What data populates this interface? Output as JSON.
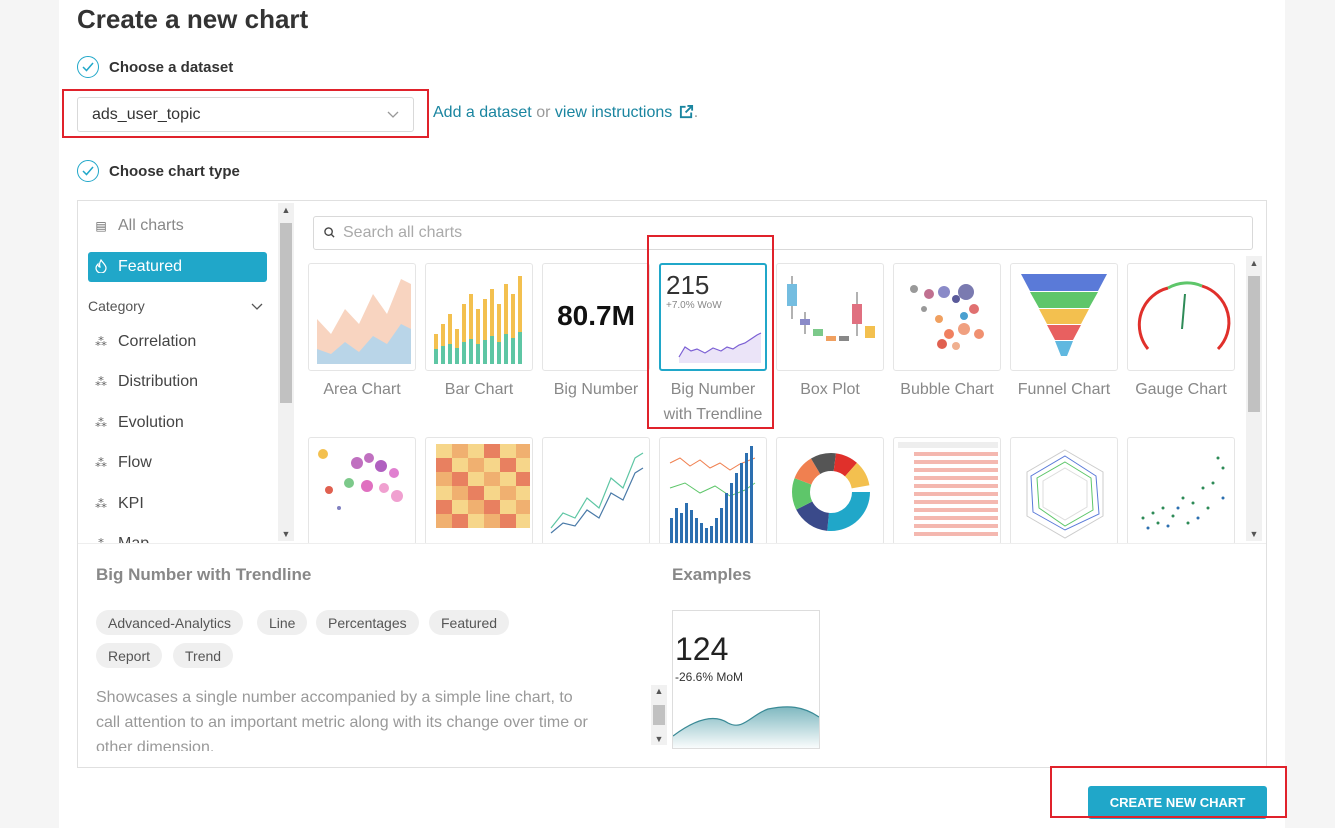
{
  "title": "Create a new chart",
  "steps": {
    "dataset": "Choose a dataset",
    "chart_type": "Choose chart type"
  },
  "dataset": {
    "value": "ads_user_topic",
    "add_link": "Add a dataset",
    "or": "or",
    "instructions_link": "view instructions",
    "period": "."
  },
  "sidebar": {
    "all_charts": "All charts",
    "featured": "Featured",
    "category_label": "Category",
    "categories": [
      "Correlation",
      "Distribution",
      "Evolution",
      "Flow",
      "KPI",
      "Map"
    ]
  },
  "search": {
    "placeholder": "Search all charts"
  },
  "charts": [
    {
      "name": "Area Chart"
    },
    {
      "name": "Bar Chart"
    },
    {
      "name": "Big Number",
      "thumb_value": "80.7M"
    },
    {
      "name": "Big Number with Trendline",
      "line1": "Big Number",
      "line2": "with Trendline",
      "thumb_value": "215",
      "thumb_sub": "+7.0% WoW",
      "selected": true
    },
    {
      "name": "Box Plot"
    },
    {
      "name": "Bubble Chart"
    },
    {
      "name": "Funnel Chart"
    },
    {
      "name": "Gauge Chart"
    }
  ],
  "detail": {
    "title": "Big Number with Trendline",
    "tags": [
      "Advanced-Analytics",
      "Line",
      "Percentages",
      "Featured",
      "Report",
      "Trend"
    ],
    "description": "Showcases a single number accompanied by a simple line chart, to call attention to an important metric along with its change over time or other dimension.",
    "examples_label": "Examples",
    "example_value": "124",
    "example_sub": "-26.6% MoM"
  },
  "create_button": "CREATE NEW CHART",
  "colors": {
    "accent": "#20a7c9",
    "highlight": "#e0222b"
  }
}
